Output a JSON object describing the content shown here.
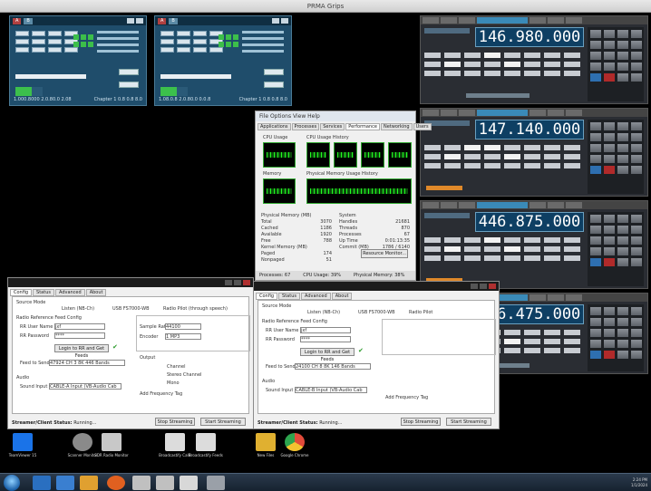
{
  "window_title": "PRMA Grips",
  "control_panels": [
    {
      "tabs": [
        "A",
        "B"
      ],
      "footer_left": "1.000.8000 2.0.80.0 2.08",
      "footer_right": "Chapter 1 0.8 0.8 8.0"
    },
    {
      "tabs": [
        "A",
        "B"
      ],
      "footer_left": "1.08.0.8 2.0.80.0 0.0.8",
      "footer_right": "Chapter 1 0.8 0.8 8.0"
    }
  ],
  "radios": [
    {
      "frequency": "146.980.000"
    },
    {
      "frequency": "147.140.000"
    },
    {
      "frequency": "446.875.000"
    },
    {
      "frequency": "446.475.000"
    }
  ],
  "task_manager": {
    "title": "File  Options  View  Help",
    "tabs": [
      "Applications",
      "Processes",
      "Services",
      "Performance",
      "Networking",
      "Users"
    ],
    "cpu_usage_label": "CPU Usage",
    "cpu_history_label": "CPU Usage History",
    "memory_label": "Memory",
    "memory_history_label": "Physical Memory Usage History",
    "physical_memory_title": "Physical Memory (MB)",
    "physical_rows": [
      [
        "Total",
        "3070"
      ],
      [
        "Cached",
        "1186"
      ],
      [
        "Available",
        "1920"
      ],
      [
        "Free",
        "788"
      ]
    ],
    "kernel_memory_title": "Kernel Memory (MB)",
    "kernel_rows": [
      [
        "Paged",
        "174"
      ],
      [
        "Nonpaged",
        "51"
      ]
    ],
    "system_title": "System",
    "system_rows": [
      [
        "Handles",
        "21681"
      ],
      [
        "Threads",
        "870"
      ],
      [
        "Processes",
        "67"
      ],
      [
        "Up Time",
        "0:01:13:35"
      ],
      [
        "Commit (MB)",
        "1786 / 6140"
      ]
    ],
    "resource_monitor_button": "Resource Monitor...",
    "status": [
      "Processes: 67",
      "CPU Usage: 39%",
      "Physical Memory: 38%"
    ]
  },
  "config_windows": [
    {
      "tabs": [
        "Config",
        "Status",
        "Advanced",
        "About"
      ],
      "source_mode_label": "Source Mode",
      "source_options": [
        "Listen (NB-Ch)",
        "USB FS7000-WB",
        "Radio Pilot (through speech)"
      ],
      "radio_ref_label": "Radio Reference Feed Config",
      "rr_user_label": "RR User Name",
      "rr_user_value": "jxf",
      "rr_pass_label": "RR Password",
      "rr_pass_value": "****",
      "login_button": "Login to RR and Get Feeds",
      "feed_label": "Feed to Send",
      "feed_value": "47924 CH 3 8K 446 Bands",
      "input_label": "Audio",
      "sound_label": "Sound Input",
      "sound_value": "CABLE-A Input (VB-Audio Cab",
      "stats_label": "Sample Rate",
      "stats_value": "44100",
      "encoder_label": "Encoder",
      "encoder_value": "1 MP3",
      "output_label": "Output",
      "output_options": [
        "Channel",
        "Stereo Channel",
        "Mono"
      ],
      "add_freq_label": "Add Frequency Tag",
      "stop_button": "Stop Streaming",
      "start_button": "Start Streaming",
      "status_label": "Streamer/Client Status:",
      "status_value": "Running..."
    },
    {
      "tabs": [
        "Config",
        "Status",
        "Advanced",
        "About"
      ],
      "source_mode_label": "Source Mode",
      "source_options": [
        "Listen (NB-Ch)",
        "USB FS7000-WB",
        "Radio Pilot"
      ],
      "radio_ref_label": "Radio Reference Feed Config",
      "rr_user_label": "RR User Name",
      "rr_user_value": "jxf",
      "rr_pass_label": "RR Password",
      "rr_pass_value": "****",
      "login_button": "Login to RR and Get Feeds",
      "feed_label": "Feed to Send",
      "feed_value": "24100 CH 8 8K 146 Bands",
      "input_label": "Audio",
      "sound_label": "Sound Input",
      "sound_value": "CABLE-B Input (VB-Audio Cab",
      "stats_label": "Sample Rate",
      "stats_value": "",
      "encoder_label": "Encoder",
      "encoder_value": "",
      "output_label": "Output",
      "output_options": [
        "",
        "",
        ""
      ],
      "add_freq_label": "Add Frequency Tag",
      "stop_button": "Stop Streaming",
      "start_button": "Start Streaming",
      "status_label": "Streamer/Client Status:",
      "status_value": "Running..."
    }
  ],
  "desktop_icons": [
    {
      "label": "TeamViewer 15",
      "color": "#1a73e8"
    },
    {
      "label": "Scanner Monitor",
      "color": "#8a8a8a"
    },
    {
      "label": "SDR Radio Monitor",
      "color": "#c8c8c8"
    },
    {
      "label": "Broadcastify Calls",
      "color": "#dcdcdc"
    },
    {
      "label": "Broadcastify Feeds",
      "color": "#dcdcdc"
    },
    {
      "label": "New Files",
      "color": "#e0b030"
    },
    {
      "label": "Google Chrome",
      "color": "#e04a3a"
    }
  ],
  "taskbar": {
    "apps": [
      "#2a6fc0",
      "#3a7fd0",
      "#e0a030",
      "#d0d0d0",
      "#e06020",
      "#c0c0c0",
      "#c0c0c0",
      "#d8d8d8",
      "#9aa0a8"
    ],
    "time": "2:24 PM",
    "date": "1/1/2024"
  }
}
